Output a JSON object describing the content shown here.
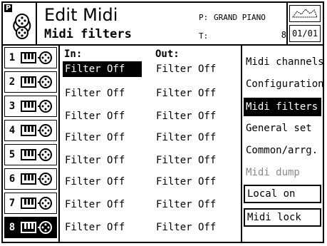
{
  "header": {
    "title": "Edit Midi",
    "subtitle": "Midi filters",
    "p_label": "P:",
    "p_value": "GRAND PIANO",
    "t_label": "T:",
    "t_value": "8",
    "page_counter": "01/01",
    "badge": "P"
  },
  "tracks": [
    {
      "number": "1"
    },
    {
      "number": "2"
    },
    {
      "number": "3"
    },
    {
      "number": "4"
    },
    {
      "number": "5"
    },
    {
      "number": "6"
    },
    {
      "number": "7"
    },
    {
      "number": "8"
    }
  ],
  "selected_track": 8,
  "filters": {
    "in_header": "In:",
    "out_header": "Out:",
    "rows": [
      {
        "in": "Filter Off",
        "out": "Filter Off"
      },
      {
        "in": "Filter Off",
        "out": "Filter Off"
      },
      {
        "in": "Filter Off",
        "out": "Filter Off"
      },
      {
        "in": "Filter Off",
        "out": "Filter Off"
      },
      {
        "in": "Filter Off",
        "out": "Filter Off"
      },
      {
        "in": "Filter Off",
        "out": "Filter Off"
      },
      {
        "in": "Filter Off",
        "out": "Filter Off"
      },
      {
        "in": "Filter Off",
        "out": "Filter Off"
      }
    ]
  },
  "menu": {
    "items": [
      {
        "label": "Midi channels"
      },
      {
        "label": "Configuration"
      },
      {
        "label": "Midi filters"
      },
      {
        "label": "General set"
      },
      {
        "label": "Common/arrg."
      },
      {
        "label": "Midi dump"
      },
      {
        "label": "Local on"
      },
      {
        "label": "Midi lock"
      }
    ]
  }
}
